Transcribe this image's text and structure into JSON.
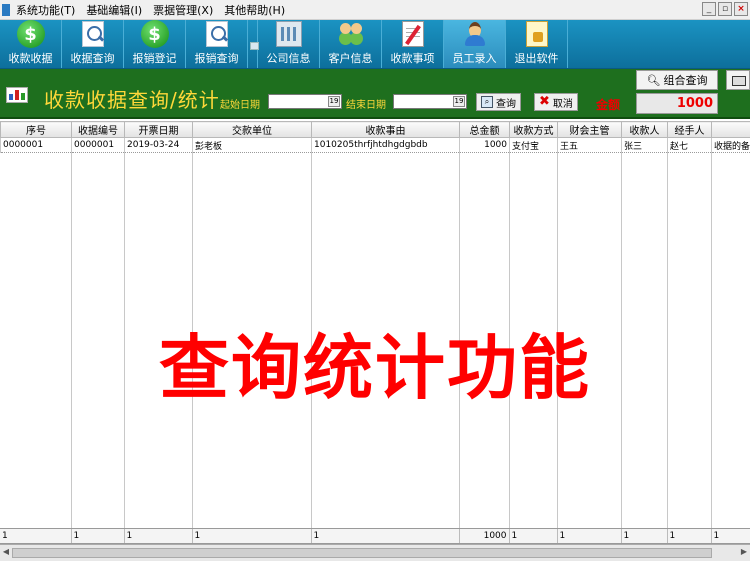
{
  "menu": {
    "items": [
      "系统功能(T)",
      "基础编辑(I)",
      "票据管理(X)",
      "其他帮助(H)"
    ]
  },
  "toolbar": {
    "buttons": [
      {
        "label": "收款收据",
        "icon": "dollar-icon"
      },
      {
        "label": "收据查询",
        "icon": "search-doc-icon"
      },
      {
        "label": "报销登记",
        "icon": "dollar-icon"
      },
      {
        "label": "报销查询",
        "icon": "search-doc-icon"
      },
      {
        "label": "公司信息",
        "icon": "building-icon"
      },
      {
        "label": "客户信息",
        "icon": "people-icon"
      },
      {
        "label": "收款事项",
        "icon": "notepad-icon"
      },
      {
        "label": "员工录入",
        "icon": "user-icon"
      },
      {
        "label": "退出软件",
        "icon": "exit-icon"
      }
    ]
  },
  "header": {
    "title": "收款收据查询/统计",
    "start_date_label": "起始日期",
    "end_date_label": "结束日期",
    "query_button": "查询",
    "cancel_button": "取消",
    "amount_label": "金额",
    "amount_value": "1000",
    "combo_query_button": "组合查询"
  },
  "table": {
    "columns": [
      "序号",
      "收据编号",
      "开票日期",
      "交款单位",
      "收款事由",
      "总金额",
      "收款方式",
      "财会主管",
      "收款人",
      "经手人",
      ""
    ],
    "rows": [
      [
        "0000001",
        "0000001",
        "2019-03-24",
        "彭老板",
        "1010205thrfjhtdhgdgbdb",
        "1000",
        "支付宝",
        "王五",
        "张三",
        "赵七",
        "收据的备"
      ]
    ],
    "totals": [
      "1",
      "1",
      "1",
      "1",
      "1",
      "1000",
      "1",
      "1",
      "1",
      "1",
      "1"
    ]
  },
  "overlay_text": "查询统计功能",
  "colors": {
    "toolbar": "#1b93c2",
    "header": "#1e6f1e",
    "title": "#ffd83a",
    "overlay": "#ff0000"
  }
}
